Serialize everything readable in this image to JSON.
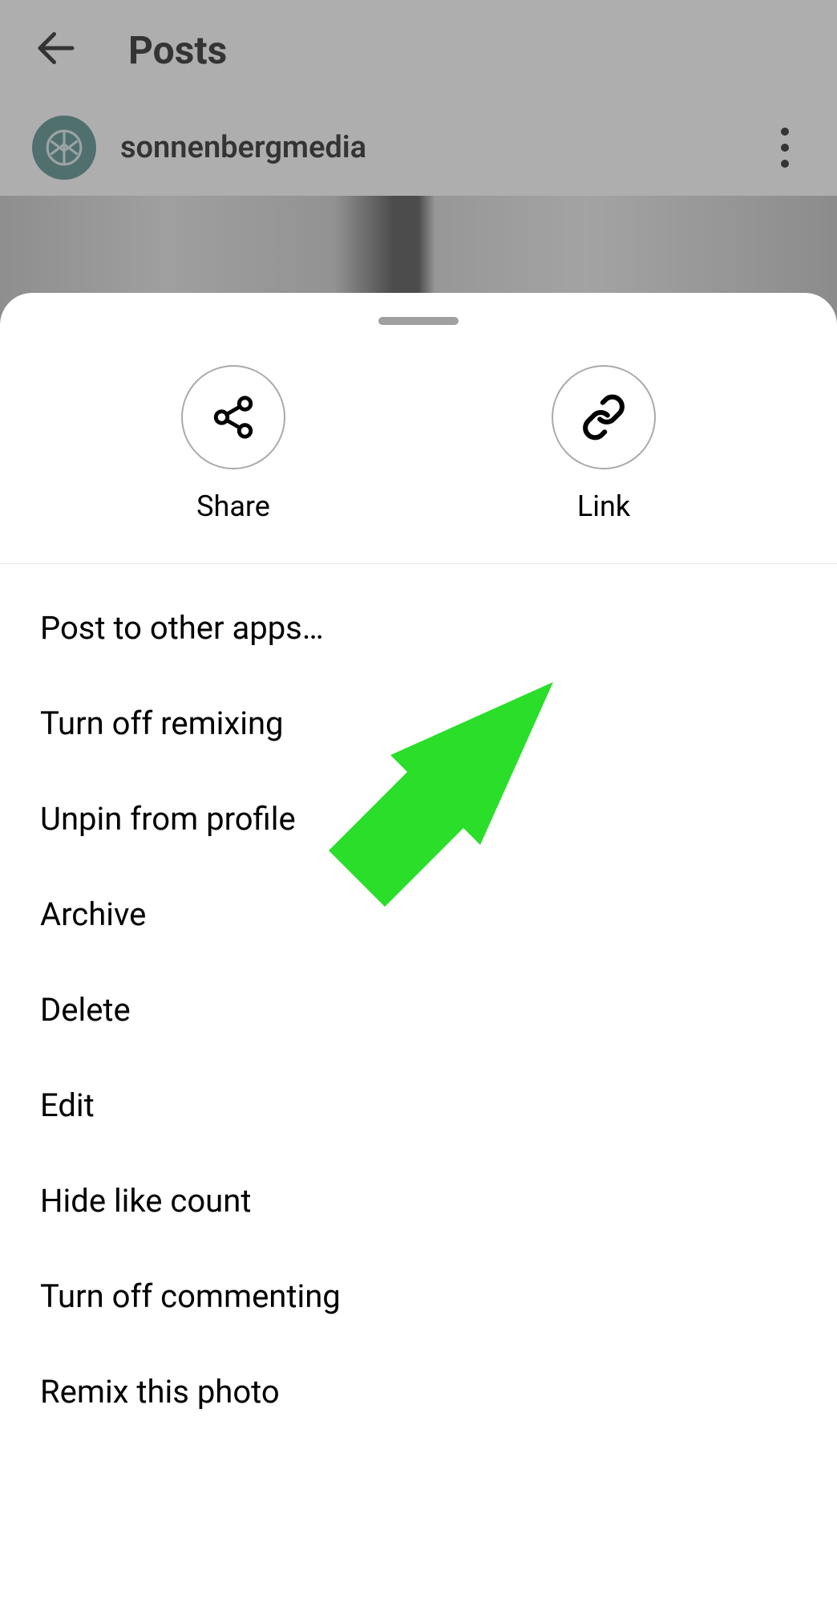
{
  "header": {
    "title": "Posts"
  },
  "profile": {
    "username": "sonnenbergmedia"
  },
  "sheet": {
    "actions": {
      "share": "Share",
      "link": "Link"
    },
    "menu": [
      "Post to other apps…",
      "Turn off remixing",
      "Unpin from profile",
      "Archive",
      "Delete",
      "Edit",
      "Hide like count",
      "Turn off commenting",
      "Remix this photo"
    ]
  },
  "annotation": {
    "arrow_color": "#2ade2a",
    "target_item": "Unpin from profile"
  }
}
